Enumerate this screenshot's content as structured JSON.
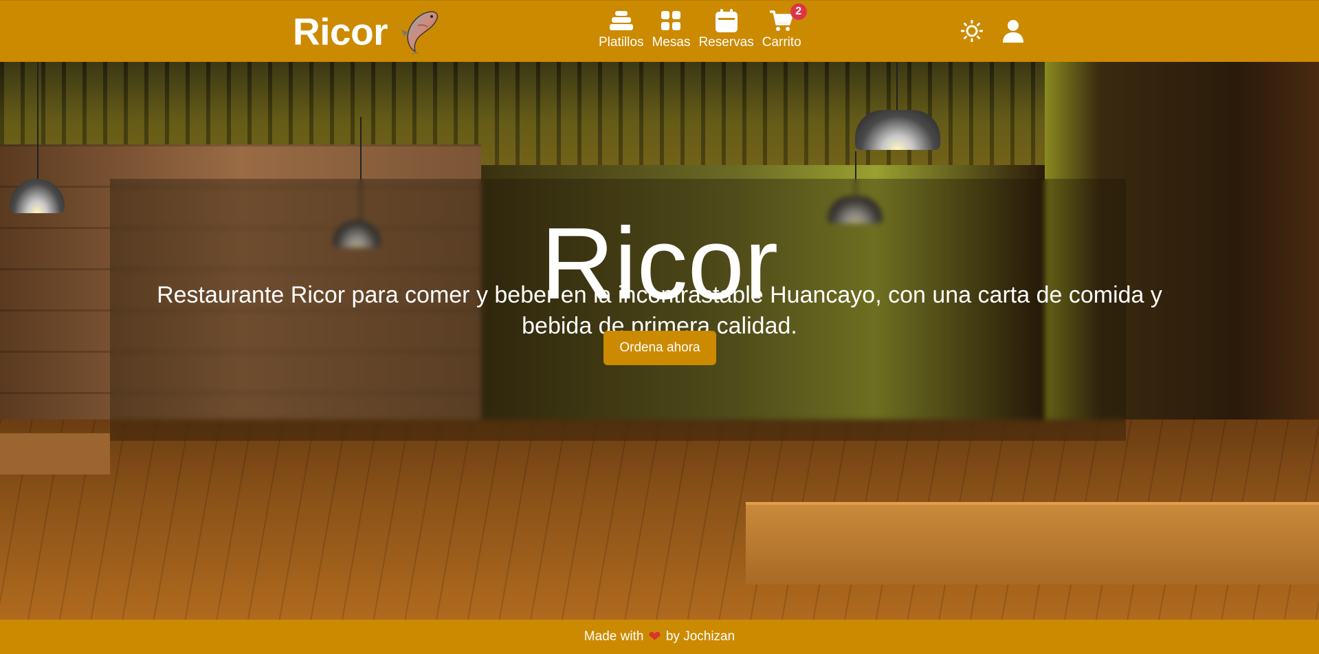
{
  "header": {
    "brand": "Ricor",
    "nav": [
      {
        "label": "Platillos",
        "icon": "dishes-icon"
      },
      {
        "label": "Mesas",
        "icon": "grid-icon"
      },
      {
        "label": "Reservas",
        "icon": "calendar-icon"
      },
      {
        "label": "Carrito",
        "icon": "cart-icon",
        "badge": "2"
      }
    ],
    "right_icons": [
      "sun-icon",
      "user-icon"
    ]
  },
  "hero": {
    "title": "Ricor",
    "subtitle": "Restaurante Ricor para comer y beber en la incontrastable Huancayo, con una carta de comida y bebida de primera calidad.",
    "cta": "Ordena ahora"
  },
  "footer": {
    "made_with": "Made with",
    "by": "by Jochizan"
  },
  "colors": {
    "primary": "#cc8a00",
    "badge": "#dc3545",
    "heart": "#d9342b",
    "text": "#ffffff"
  }
}
